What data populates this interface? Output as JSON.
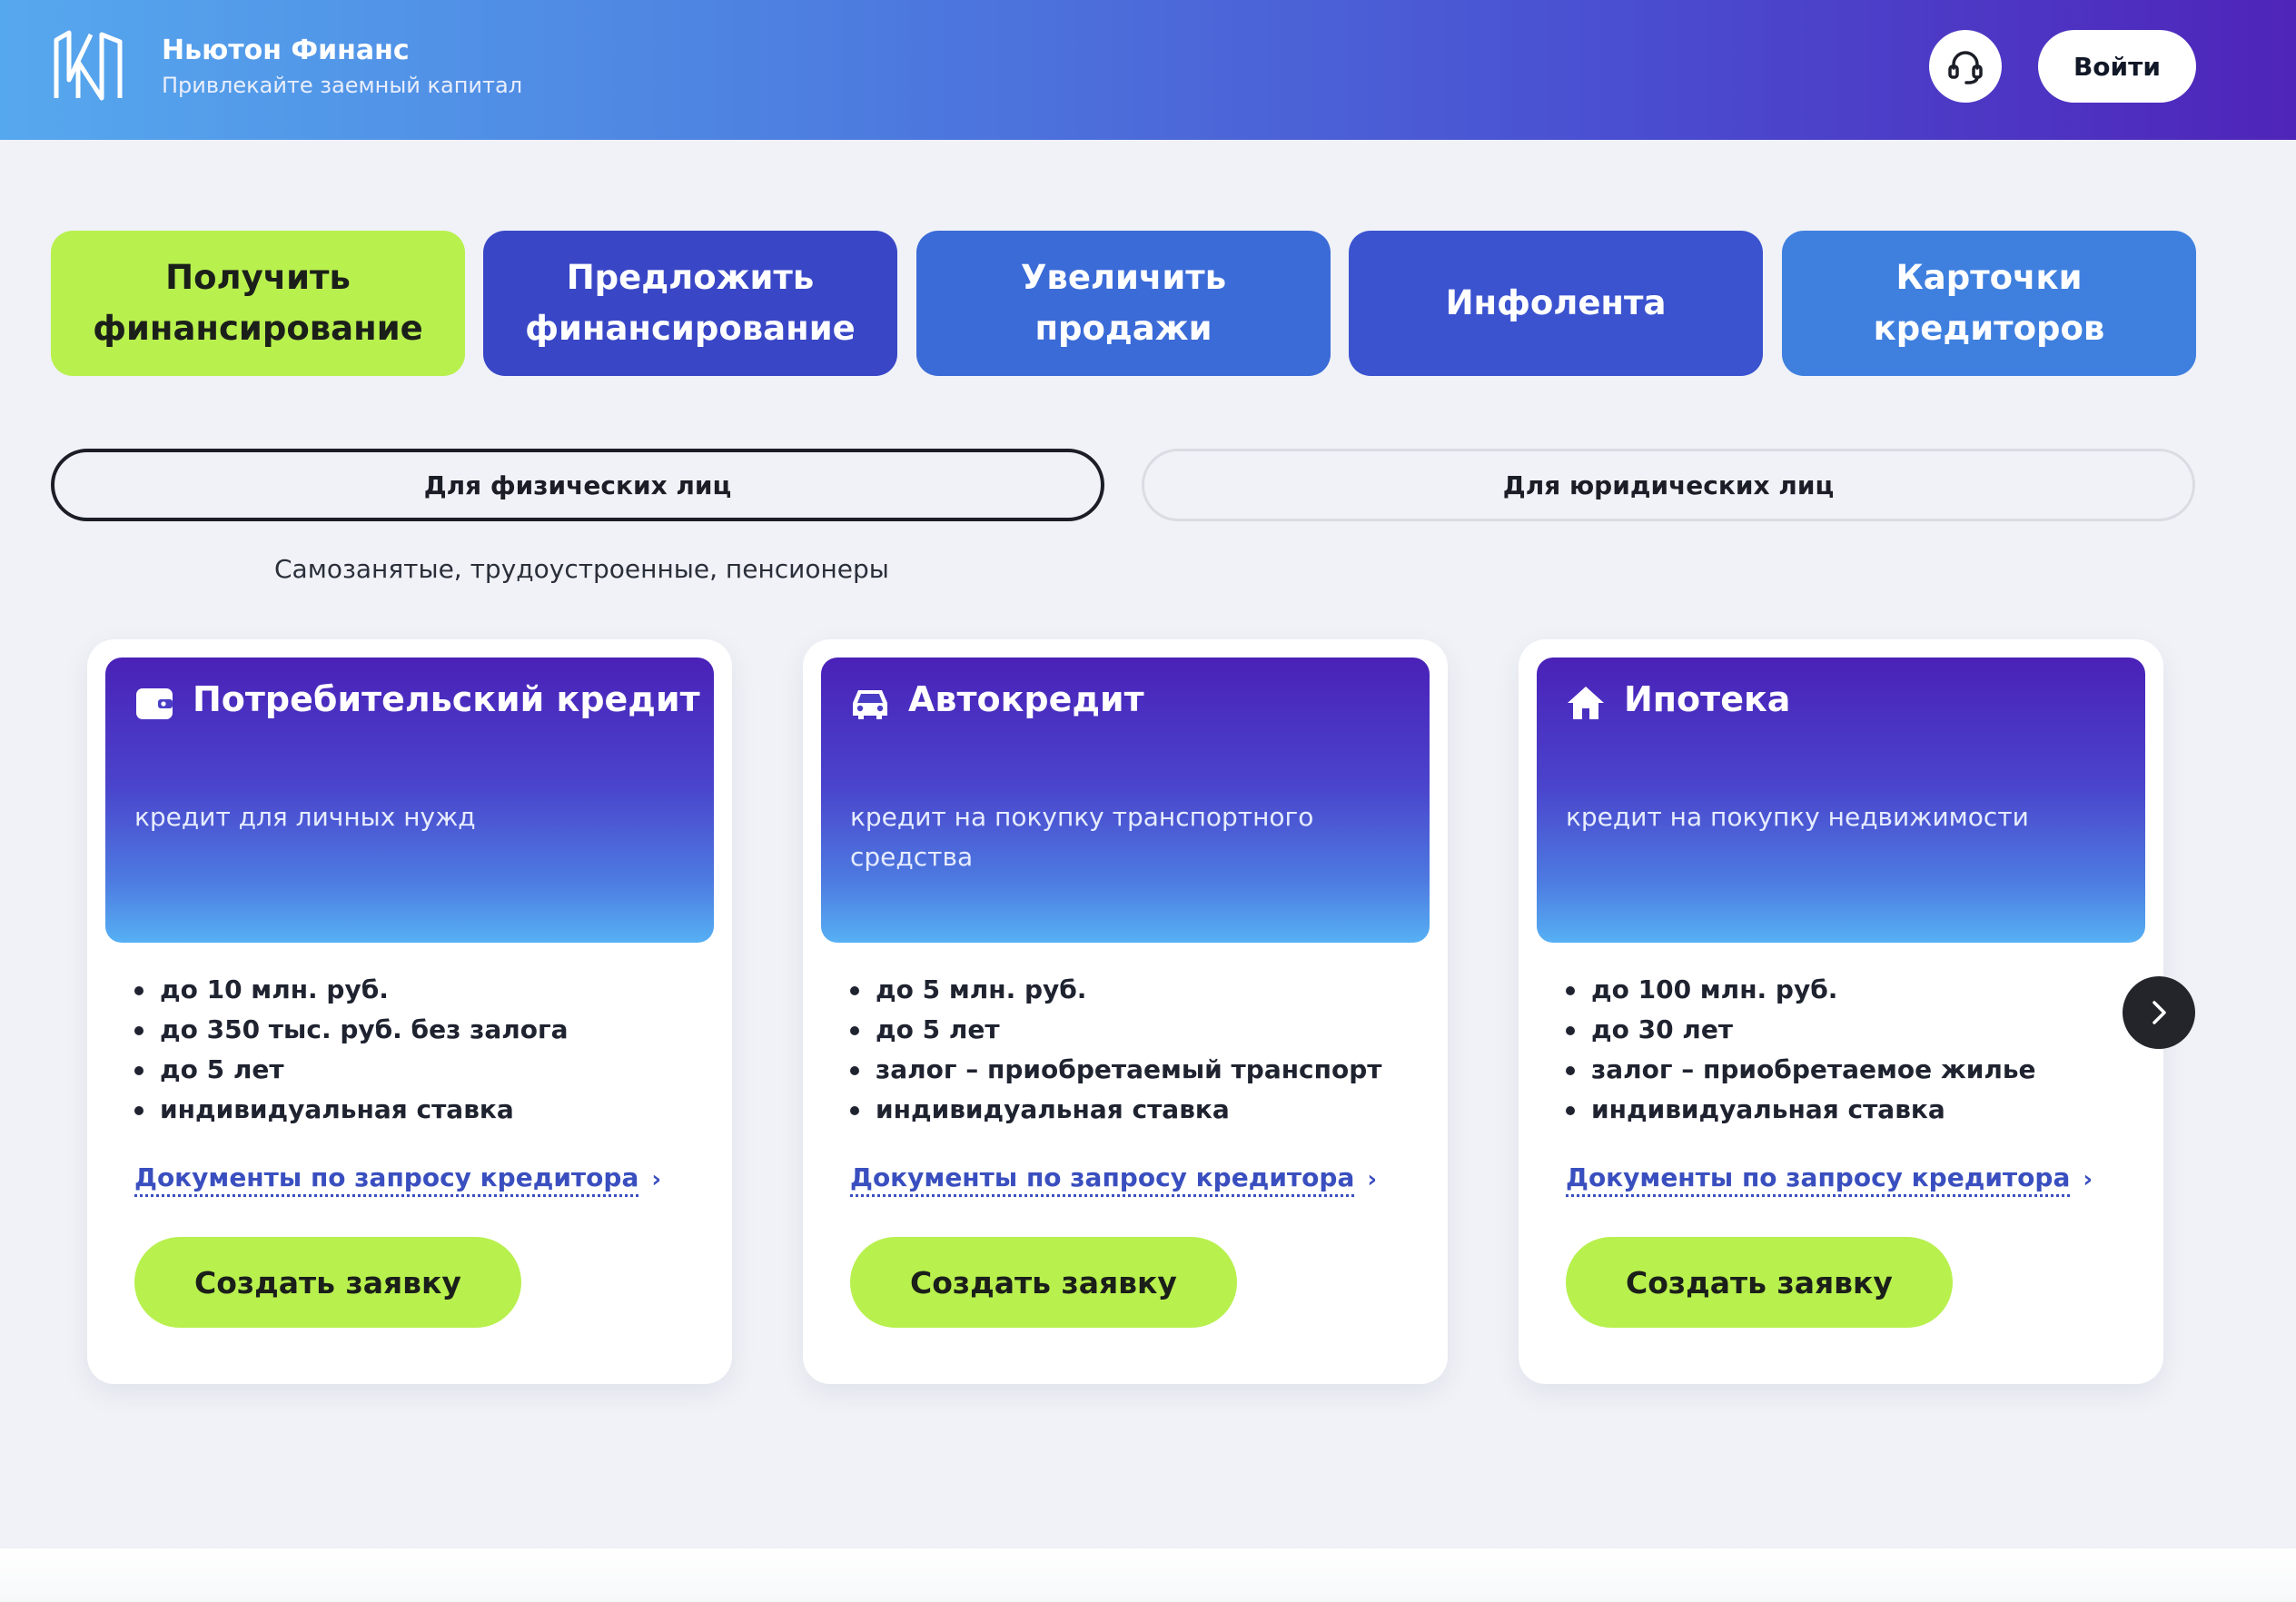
{
  "header": {
    "brand_title": "Ньютон Финанс",
    "brand_tagline": "Привлекайте заемный капитал",
    "support_icon": "headset-icon",
    "login_label": "Войти",
    "gradient_colors": [
      "#56a8ee",
      "#4a4fd1",
      "#4f24b9"
    ]
  },
  "nav": [
    {
      "line1": "Получить",
      "line2": "финансирование",
      "color": "#b8f04e"
    },
    {
      "line1": "Предложить",
      "line2": "финансирование",
      "color": "#3947c6"
    },
    {
      "line1": "Увеличить",
      "line2": "продажи",
      "color": "#3b6bd7"
    },
    {
      "line1": "Инфолента",
      "line2": "",
      "color": "#3b53cf"
    },
    {
      "line1": "Карточки",
      "line2": "кредиторов",
      "color": "#3f80df"
    }
  ],
  "segments": {
    "individuals": "Для физических лиц",
    "legal": "Для юридических лиц",
    "active": "individuals",
    "caption": "Самозанятые, трудоустроенные, пенсионеры"
  },
  "cards": [
    {
      "icon": "wallet-icon",
      "title": "Потребительский кредит",
      "description": "кредит для личных нужд",
      "features": [
        "до 10 млн. руб.",
        "до 350 тыс. руб. без залога",
        "до 5 лет",
        "индивидуальная ставка"
      ],
      "docs_link": "Документы по запросу кредитора",
      "docs_arrow": "›",
      "button": "Создать заявку"
    },
    {
      "icon": "car-icon",
      "title": "Автокредит",
      "description": "кредит на покупку транспортного средства",
      "features": [
        "до 5 млн. руб.",
        "до 5 лет",
        "залог – приобретаемый транспорт",
        "индивидуальная ставка"
      ],
      "docs_link": "Документы по запросу кредитора",
      "docs_arrow": "›",
      "button": "Создать заявку"
    },
    {
      "icon": "home-icon",
      "title": "Ипотека",
      "description": "кредит на покупку недвижимости",
      "features": [
        "до 100 млн. руб.",
        "до 30 лет",
        "залог – приобретаемое жилье",
        "индивидуальная ставка"
      ],
      "docs_link": "Документы по запросу кредитора",
      "docs_arrow": "›",
      "button": "Создать заявку"
    }
  ],
  "carousel": {
    "next_icon": "chevron-right-icon"
  },
  "colors": {
    "accent_green": "#b8f04e",
    "link_blue": "#3a4fbf",
    "background": "#f0f2f7"
  }
}
